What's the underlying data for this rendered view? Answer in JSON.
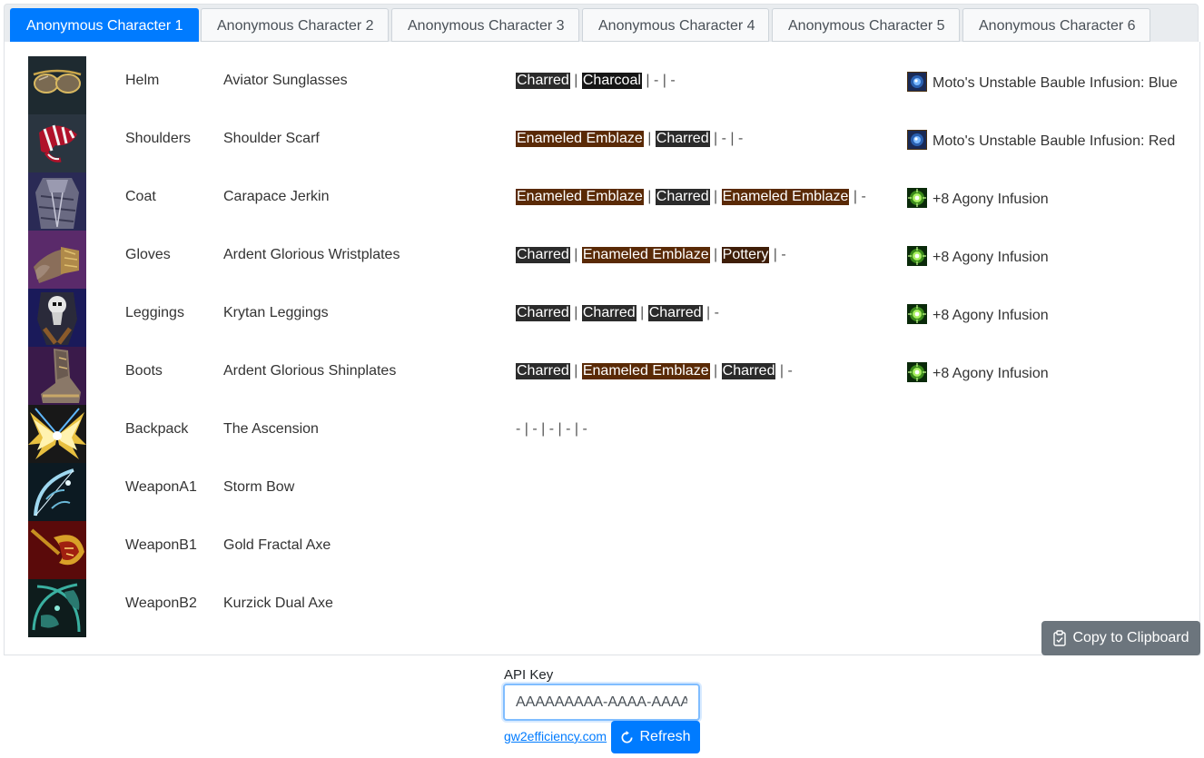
{
  "tabs": [
    {
      "label": "Anonymous Character 1",
      "active": true
    },
    {
      "label": "Anonymous Character 2",
      "active": false
    },
    {
      "label": "Anonymous Character 3",
      "active": false
    },
    {
      "label": "Anonymous Character 4",
      "active": false
    },
    {
      "label": "Anonymous Character 5",
      "active": false
    },
    {
      "label": "Anonymous Character 6",
      "active": false
    }
  ],
  "colors": {
    "accent": "#007bff",
    "dye_charred": "#2b2b2b",
    "dye_charcoal": "#161616",
    "dye_enameled_emblaze": "#5a2a06",
    "dye_pottery": "#3f1e08"
  },
  "equipment": [
    {
      "slot": "Helm",
      "item": "Aviator Sunglasses",
      "icon": "aviator-sunglasses-icon",
      "dyes": [
        "Charred",
        "Charcoal",
        "-",
        "-"
      ],
      "infusion": {
        "label": "Moto's Unstable Bauble Infusion: Blue",
        "icon": "bauble-infusion-icon"
      }
    },
    {
      "slot": "Shoulders",
      "item": "Shoulder Scarf",
      "icon": "shoulder-scarf-icon",
      "dyes": [
        "Enameled Emblaze",
        "Charred",
        "-",
        "-"
      ],
      "infusion": {
        "label": "Moto's Unstable Bauble Infusion: Red",
        "icon": "bauble-infusion-icon"
      }
    },
    {
      "slot": "Coat",
      "item": "Carapace Jerkin",
      "icon": "carapace-jerkin-icon",
      "dyes": [
        "Enameled Emblaze",
        "Charred",
        "Enameled Emblaze",
        "-"
      ],
      "infusion": {
        "label": "+8 Agony Infusion",
        "icon": "agony-infusion-icon"
      }
    },
    {
      "slot": "Gloves",
      "item": "Ardent Glorious Wristplates",
      "icon": "wristplates-icon",
      "dyes": [
        "Charred",
        "Enameled Emblaze",
        "Pottery",
        "-"
      ],
      "infusion": {
        "label": "+8 Agony Infusion",
        "icon": "agony-infusion-icon"
      }
    },
    {
      "slot": "Leggings",
      "item": "Krytan Leggings",
      "icon": "krytan-leggings-icon",
      "dyes": [
        "Charred",
        "Charred",
        "Charred",
        "-"
      ],
      "infusion": {
        "label": "+8 Agony Infusion",
        "icon": "agony-infusion-icon"
      }
    },
    {
      "slot": "Boots",
      "item": "Ardent Glorious Shinplates",
      "icon": "shinplates-icon",
      "dyes": [
        "Charred",
        "Enameled Emblaze",
        "Charred",
        "-"
      ],
      "infusion": {
        "label": "+8 Agony Infusion",
        "icon": "agony-infusion-icon"
      }
    },
    {
      "slot": "Backpack",
      "item": "The Ascension",
      "icon": "ascension-backpack-icon",
      "dyes": [
        "-",
        "-",
        "-",
        "-",
        "-"
      ],
      "infusion": null
    },
    {
      "slot": "WeaponA1",
      "item": "Storm Bow",
      "icon": "storm-bow-icon",
      "dyes": [],
      "infusion": null
    },
    {
      "slot": "WeaponB1",
      "item": "Gold Fractal Axe",
      "icon": "gold-fractal-axe-icon",
      "dyes": [],
      "infusion": null
    },
    {
      "slot": "WeaponB2",
      "item": "Kurzick Dual Axe",
      "icon": "kurzick-dual-axe-icon",
      "dyes": [],
      "infusion": null
    }
  ],
  "copy_button": {
    "label": "Copy to Clipboard",
    "icon": "clipboard-icon"
  },
  "api": {
    "label": "API Key",
    "value": "AAAAAAAAA-AAAA-AAAA-",
    "link_text": "gw2efficiency.com",
    "refresh_label": "Refresh",
    "refresh_icon": "refresh-icon"
  }
}
